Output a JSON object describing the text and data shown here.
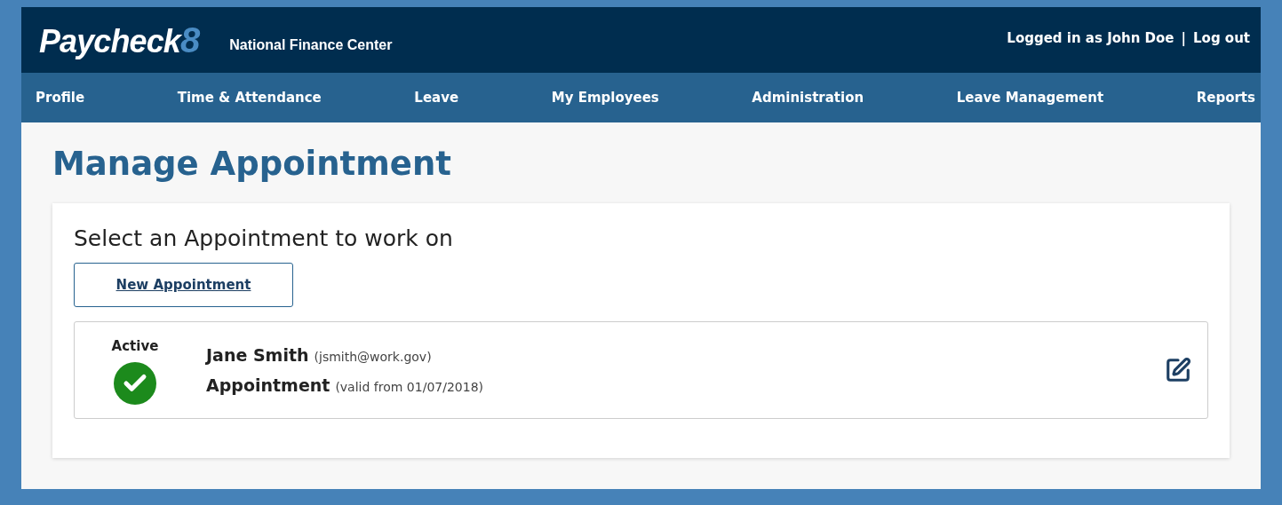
{
  "header": {
    "logo": {
      "word": "Paycheck",
      "mark": "8"
    },
    "subtitle": "National Finance Center",
    "user_text": "Logged in as John Doe",
    "separator": "|",
    "logout": "Log out"
  },
  "nav": [
    "Profile",
    "Time & Attendance",
    "Leave",
    "My Employees",
    "Administration",
    "Leave Management",
    "Reports"
  ],
  "page_title": "Manage Appointment",
  "panel": {
    "heading": "Select an Appointment to work on",
    "new_button": "New Appointment",
    "appointments": [
      {
        "status": "Active",
        "active": true,
        "name": "Jane Smith",
        "email": "(jsmith@work.gov)",
        "title": "Appointment",
        "validity": "(valid from 01/07/2018)"
      }
    ]
  }
}
